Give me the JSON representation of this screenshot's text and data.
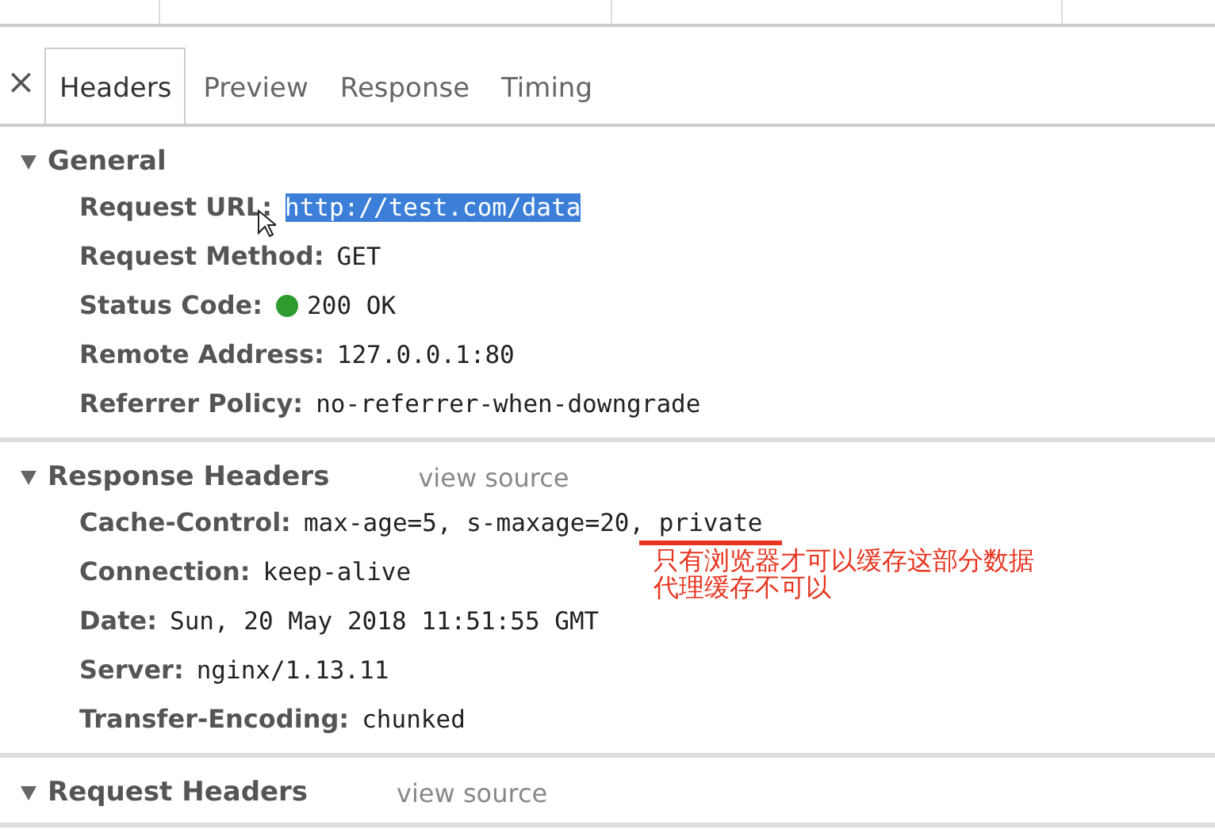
{
  "close_button": "×",
  "tabs": [
    {
      "label": "Headers",
      "selected": true
    },
    {
      "label": "Preview",
      "selected": false
    },
    {
      "label": "Response",
      "selected": false
    },
    {
      "label": "Timing",
      "selected": false
    }
  ],
  "sections": [
    {
      "title": "General",
      "expanded": true,
      "rows": [
        {
          "kind": "text",
          "name": "Request URL:",
          "value": "http://test.com/data",
          "highlighted": true
        },
        {
          "kind": "text",
          "name": "Request Method:",
          "value": "GET",
          "highlighted": false
        },
        {
          "kind": "status",
          "name": "Status Code:",
          "value": "200 OK",
          "highlighted": false,
          "color": "#2e9b2e"
        },
        {
          "kind": "text",
          "name": "Remote Address:",
          "value": "127.0.0.1:80",
          "highlighted": false
        },
        {
          "kind": "text",
          "name": "Referrer Policy:",
          "value": "no-referrer-when-downgrade",
          "highlighted": false
        }
      ]
    },
    {
      "title": "Response Headers",
      "expanded": true,
      "view_source": "view source",
      "rows": [
        {
          "kind": "text",
          "name": "Cache-Control:",
          "value": "max-age=5, s-maxage=20, private",
          "highlighted": false,
          "note": [
            "只有浏览器才可以缓存这部分数据",
            "代理缓存不可以"
          ]
        },
        {
          "kind": "text",
          "name": "Connection:",
          "value": "keep-alive",
          "highlighted": false
        },
        {
          "kind": "text",
          "name": "Date:",
          "value": "Sun, 20 May 2018 11:51:55 GMT",
          "highlighted": false
        },
        {
          "kind": "text",
          "name": "Server:",
          "value": "nginx/1.13.11",
          "highlighted": false
        },
        {
          "kind": "text",
          "name": "Transfer-Encoding:",
          "value": "chunked",
          "highlighted": false
        }
      ]
    },
    {
      "title": "Request Headers",
      "expanded": true,
      "view_source": "view source"
    }
  ]
}
